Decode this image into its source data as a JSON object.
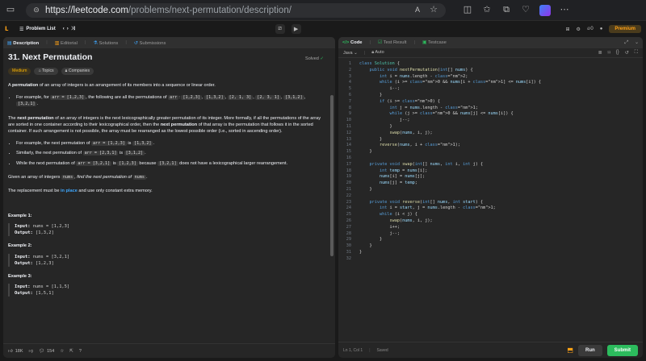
{
  "browser": {
    "url_prefix": "https://leetcode.com",
    "url_path": "/problems/next-permutation/description/"
  },
  "lc_nav": {
    "problem_list": "Problem List",
    "streak": "0",
    "premium": "Premium"
  },
  "left_tabs": [
    {
      "label": "Description"
    },
    {
      "label": "Editorial"
    },
    {
      "label": "Solutions"
    },
    {
      "label": "Submissions"
    }
  ],
  "problem": {
    "title": "31. Next Permutation",
    "status": "Solved",
    "difficulty": "Medium",
    "topics": "Topics",
    "companies": "Companies",
    "p1_bold": "permutation",
    "p1_pre": "A ",
    "p1_post": " of an array of integers is an arrangement of its members into a sequence or linear order.",
    "b1_pre": "For example, for ",
    "b1_code1": "arr = [1,2,3]",
    "b1_mid": ", the following are all the permutations of ",
    "b1_code2": "arr",
    "b1_colon": ": ",
    "b1_list": [
      "[1,2,3]",
      "[1,3,2]",
      "[2, 1, 3]",
      "[2, 3, 1]",
      "[3,1,2]",
      "[3,2,1]"
    ],
    "p2_pre": "The ",
    "p2_b1": "next permutation",
    "p2_mid": " of an array of integers is the next lexicographically greater permutation of its integer. More formally, if all the permutations of the array are sorted in one container according to their lexicographical order, then the ",
    "p2_b2": "next permutation",
    "p2_post": " of that array is the permutation that follows it in the sorted container. If such arrangement is not possible, the array must be rearranged as the lowest possible order (i.e., sorted in ascending order).",
    "b2_pre": "For example, the next permutation of ",
    "b2_code1": "arr = [1,2,3]",
    "b2_mid": " is ",
    "b2_code2": "[1,3,2]",
    "b2_post": ".",
    "b3_pre": "Similarly, the next permutation of ",
    "b3_code1": "arr = [2,3,1]",
    "b3_mid": " is ",
    "b3_code2": "[3,1,2]",
    "b3_post": ".",
    "b4_pre": "While the next permutation of ",
    "b4_code1": "arr = [3,2,1]",
    "b4_mid": " is ",
    "b4_code2": "[1,2,3]",
    "b4_post": " because ",
    "b4_code3": "[3,2,1]",
    "b4_end": " does not have a lexicographical larger rearrangement.",
    "p3_pre": "Given an array of integers ",
    "p3_code": "nums",
    "p3_ital": ", find the next permutation of ",
    "p3_code2": "nums",
    "p3_post": ".",
    "p4_pre": "The replacement must be ",
    "p4_link": "in place",
    "p4_post": " and use only constant extra memory.",
    "examples": [
      {
        "title": "Example 1:",
        "input_label": "Input:",
        "input": "nums = [1,2,3]",
        "output_label": "Output:",
        "output": "[1,3,2]"
      },
      {
        "title": "Example 2:",
        "input_label": "Input:",
        "input": "nums = [3,2,1]",
        "output_label": "Output:",
        "output": "[1,2,3]"
      },
      {
        "title": "Example 3:",
        "input_label": "Input:",
        "input": "nums = [1,1,5]",
        "output_label": "Output:",
        "output": "[1,5,1]"
      }
    ]
  },
  "left_bottom": {
    "likes": "18K",
    "comments": "154"
  },
  "code_tabs": [
    {
      "label": "Code"
    },
    {
      "label": "Test Result"
    },
    {
      "label": "Testcase"
    }
  ],
  "editor": {
    "language": "Java",
    "mode": "Auto",
    "status": "Ln 1, Col 1",
    "saved": "Saved",
    "run": "Run",
    "submit": "Submit",
    "lines": [
      "class Solution {",
      "    public void nextPermutation(int[] nums) {",
      "        int i = nums.length - 2;",
      "        while (i >= 0 && nums[i + 1] <= nums[i]) {",
      "            i--;",
      "        }",
      "        if (i >= 0) {",
      "            int j = nums.length - 1;",
      "            while (j >= 0 && nums[j] <= nums[i]) {",
      "                j--;",
      "            }",
      "            swap(nums, i, j);",
      "        }",
      "        reverse(nums, i + 1);",
      "    }",
      "",
      "    private void swap(int[] nums, int i, int j) {",
      "        int temp = nums[i];",
      "        nums[i] = nums[j];",
      "        nums[j] = temp;",
      "    }",
      "",
      "    private void reverse(int[] nums, int start) {",
      "        int i = start, j = nums.length - 1;",
      "        while (i < j) {",
      "            swap(nums, i, j);",
      "            i++;",
      "            j--;",
      "        }",
      "    }",
      "}",
      ""
    ]
  }
}
